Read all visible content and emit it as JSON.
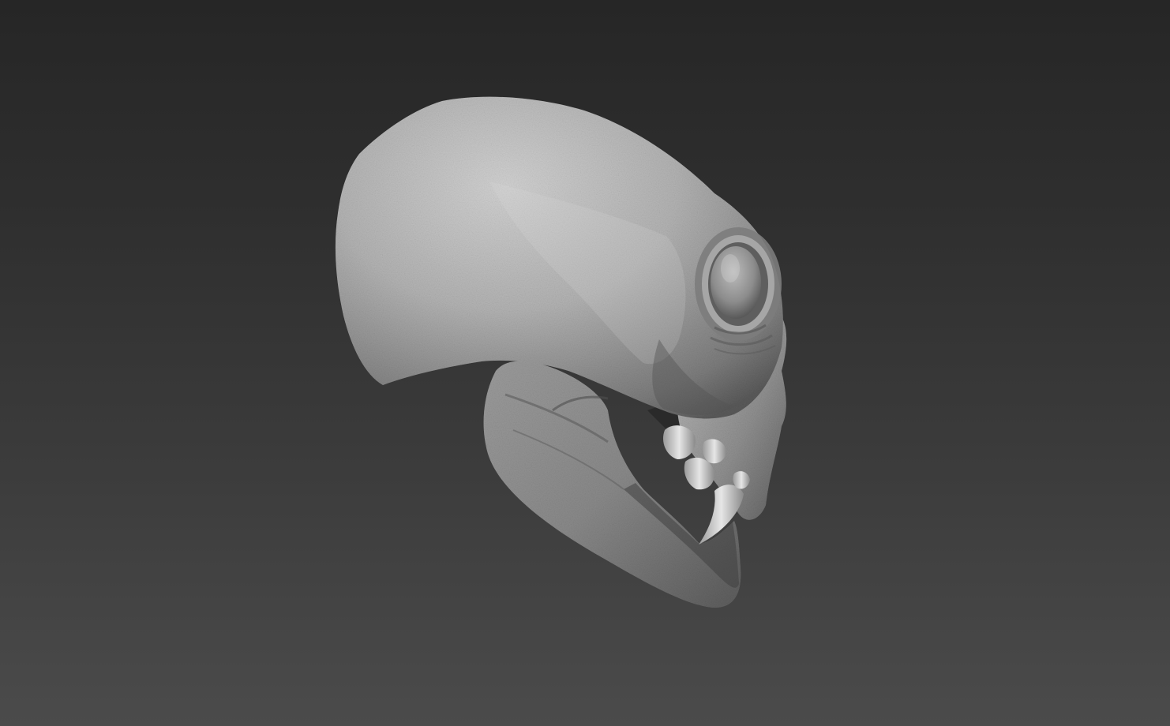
{
  "viewport": {
    "background_top": "#262626",
    "background_bottom": "#4b4b4b",
    "material_color": "#a9a9a9"
  },
  "model": {
    "icon": "alien-skull-sculpt"
  }
}
